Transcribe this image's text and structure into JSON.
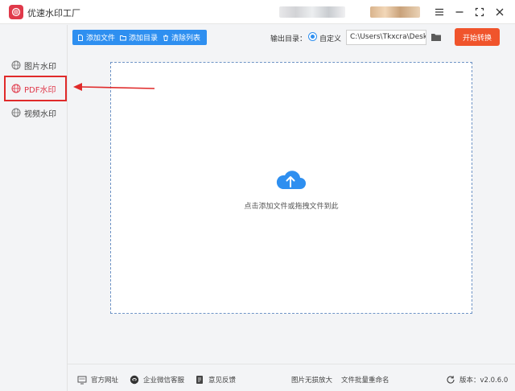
{
  "app": {
    "title": "优速水印工厂"
  },
  "sidebar": {
    "items": [
      {
        "label": "图片水印"
      },
      {
        "label": "PDF水印"
      },
      {
        "label": "视频水印"
      }
    ]
  },
  "toolbar": {
    "add_file": "添加文件",
    "add_folder": "添加目录",
    "clear_list": "清除列表"
  },
  "output": {
    "label": "输出目录：",
    "option": "自定义",
    "path": "C:\\Users\\Tkxcra\\Deskto"
  },
  "start_button": "开始转换",
  "dropzone": {
    "hint": "点击添加文件或拖拽文件到此"
  },
  "footer": {
    "website": "官方网址",
    "wechat": "企业微信客服",
    "feedback": "意见反馈",
    "enlarge": "图片无损放大",
    "rename": "文件批量重命名",
    "version": "版本：v2.0.6.0"
  },
  "colors": {
    "accent": "#2e8ff0",
    "brand": "#e0394a",
    "start": "#f0542c",
    "annotation": "#e02a2a"
  }
}
